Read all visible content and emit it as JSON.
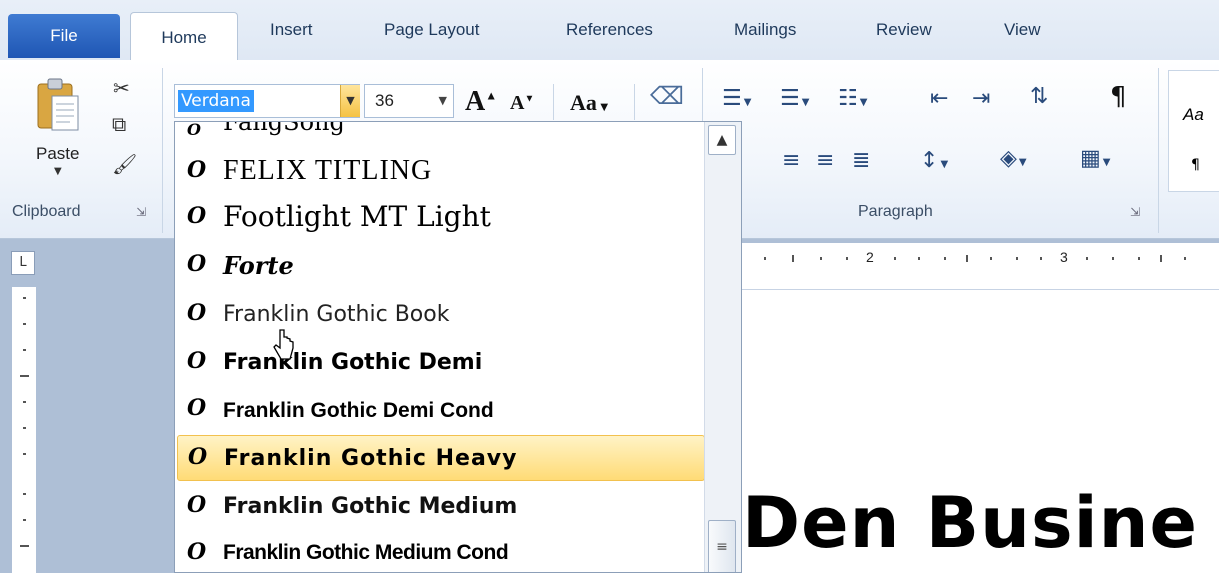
{
  "tabs": {
    "file": "File",
    "home": "Home",
    "insert": "Insert",
    "page_layout": "Page Layout",
    "references": "References",
    "mailings": "Mailings",
    "review": "Review",
    "view": "View"
  },
  "clipboard": {
    "paste_label": "Paste",
    "group_label": "Clipboard"
  },
  "font": {
    "current_font": "Verdana",
    "current_size": "36",
    "grow_font": "A",
    "shrink_font": "A",
    "change_case": "Aa"
  },
  "paragraph": {
    "group_label": "Paragraph"
  },
  "styles": {
    "preview": "Aa"
  },
  "ruler": {
    "corner_glyph": "L",
    "marks": [
      "2",
      "3"
    ]
  },
  "document": {
    "visible_text": "Den Busine"
  },
  "font_list": {
    "partial_top": "FangSong",
    "items": [
      {
        "name": "FELIX TITLING",
        "hovered": false
      },
      {
        "name": "Footlight MT Light",
        "hovered": false
      },
      {
        "name": "Forte",
        "hovered": false
      },
      {
        "name": "Franklin Gothic Book",
        "hovered": false
      },
      {
        "name": "Franklin Gothic Demi",
        "hovered": false
      },
      {
        "name": "Franklin Gothic Demi Cond",
        "hovered": false
      },
      {
        "name": "Franklin Gothic Heavy",
        "hovered": true
      },
      {
        "name": "Franklin Gothic Medium",
        "hovered": false
      },
      {
        "name": "Franklin Gothic Medium Cond",
        "hovered": false
      }
    ],
    "icon": "truetype-font-icon"
  },
  "colors": {
    "file_tab": "#2a62c0",
    "hover_item": "#ffdb76",
    "selection": "#3399ff"
  }
}
